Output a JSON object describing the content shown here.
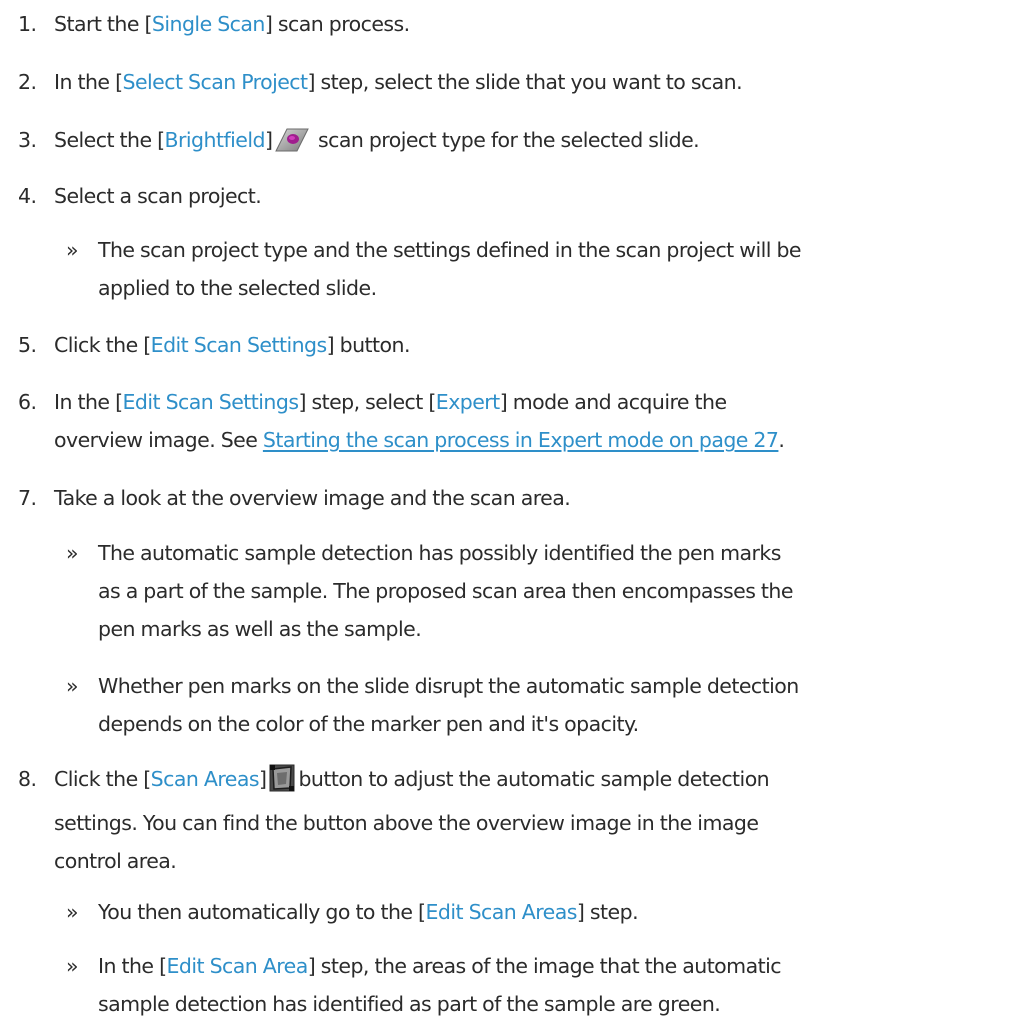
{
  "steps": [
    {
      "n": "1.",
      "pre": "Start the [",
      "ui": "Single Scan",
      "post": "] scan process."
    },
    {
      "n": "2.",
      "pre": "In the [",
      "ui": "Select Scan Project",
      "post": "] step, select the slide that you want to scan."
    },
    {
      "n": "3.",
      "pre": "Select the [",
      "ui": "Brightfield",
      "post_bracket": "]",
      "icon": "brightfield-slide-icon",
      "post": "scan project type for the selected slide."
    },
    {
      "n": "4.",
      "text": "Select a scan project."
    },
    {
      "n": "5.",
      "pre": "Click the [",
      "ui": "Edit Scan Settings",
      "post": "] button."
    },
    {
      "n": "6.",
      "pre": "In the [",
      "ui": "Edit Scan Settings",
      "mid": "] step, select [",
      "ui2": "Expert",
      "post": "] mode and acquire the",
      "line2_pre": "overview image. See ",
      "link": "Starting the scan process in Expert mode on page 27",
      "line2_post": "."
    },
    {
      "n": "7.",
      "text": "Take a look at the overview image and the scan area."
    },
    {
      "n": "8.",
      "pre": "Click the [",
      "ui": "Scan Areas",
      "post_bracket": "]",
      "icon": "scan-areas-icon",
      "post": "button to adjust the automatic sample detection",
      "line2": "settings. You can find the button above the overview image in the image",
      "line3": "control area."
    }
  ],
  "results": [
    {
      "chev": "»",
      "line1": "The scan project type and the settings defined in the scan project will be",
      "line2": "applied to the selected slide."
    },
    {
      "chev": "»",
      "line1": "The automatic sample detection has possibly identified the pen marks",
      "line2": "as a part of the sample. The proposed scan area then encompasses the",
      "line3": "pen marks as well as the sample."
    },
    {
      "chev": "»",
      "line1": "Whether pen marks on the slide disrupt the automatic sample detection",
      "line2": "depends on the color of the marker pen and it's opacity."
    },
    {
      "chev": "»",
      "pre": "You then automatically go to the [",
      "ui": "Edit Scan Areas",
      "post": "] step."
    },
    {
      "chev": "»",
      "pre": "In the [",
      "ui": "Edit Scan Area",
      "post": "] step, the areas of the image that the automatic",
      "line2": "sample detection has identified as part of the sample are green."
    }
  ],
  "colors": {
    "text": "#2b2b2b",
    "ui_term": "#2e8fc9",
    "link": "#2e8fc9"
  }
}
